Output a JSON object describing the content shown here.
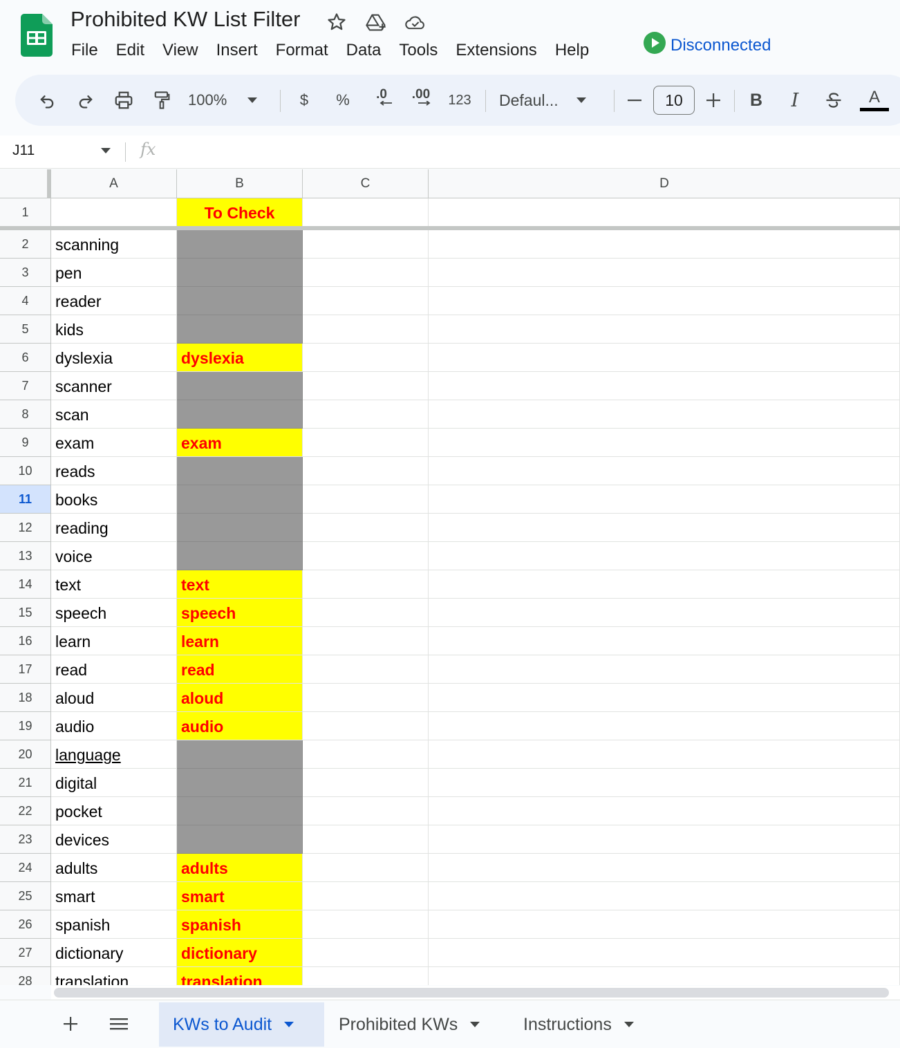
{
  "app": {
    "title": "Prohibited KW List Filter",
    "menu": [
      "File",
      "Edit",
      "View",
      "Insert",
      "Format",
      "Data",
      "Tools",
      "Extensions",
      "Help"
    ],
    "connection_status": "Disconnected"
  },
  "toolbar": {
    "zoom": "100%",
    "currency": "$",
    "percent": "%",
    "decrease_decimal": ".0",
    "increase_decimal": ".00",
    "number_format": "123",
    "font": "Defaul...",
    "font_size": "10",
    "bold": "B",
    "italic": "I",
    "text_color": "A"
  },
  "formula_bar": {
    "cell_ref": "J11",
    "fx": "fx",
    "value": ""
  },
  "sheet": {
    "columns": [
      "A",
      "B",
      "C",
      "D"
    ],
    "active_row": 11,
    "header_row": {
      "row": 1,
      "a": "",
      "b": "To Check"
    },
    "rows": [
      {
        "n": 2,
        "a": "scanning",
        "b": ""
      },
      {
        "n": 3,
        "a": "pen",
        "b": ""
      },
      {
        "n": 4,
        "a": "reader",
        "b": ""
      },
      {
        "n": 5,
        "a": "kids",
        "b": ""
      },
      {
        "n": 6,
        "a": "dyslexia",
        "b": "dyslexia"
      },
      {
        "n": 7,
        "a": "scanner",
        "b": ""
      },
      {
        "n": 8,
        "a": "scan",
        "b": ""
      },
      {
        "n": 9,
        "a": "exam",
        "b": "exam"
      },
      {
        "n": 10,
        "a": "reads",
        "b": ""
      },
      {
        "n": 11,
        "a": "books",
        "b": ""
      },
      {
        "n": 12,
        "a": "reading",
        "b": ""
      },
      {
        "n": 13,
        "a": "voice",
        "b": ""
      },
      {
        "n": 14,
        "a": "text",
        "b": "text"
      },
      {
        "n": 15,
        "a": "speech",
        "b": "speech"
      },
      {
        "n": 16,
        "a": "learn",
        "b": "learn"
      },
      {
        "n": 17,
        "a": "read",
        "b": "read"
      },
      {
        "n": 18,
        "a": "aloud",
        "b": "aloud"
      },
      {
        "n": 19,
        "a": "audio",
        "b": "audio"
      },
      {
        "n": 20,
        "a": "language",
        "b": ""
      },
      {
        "n": 21,
        "a": "digital",
        "b": ""
      },
      {
        "n": 22,
        "a": "pocket",
        "b": ""
      },
      {
        "n": 23,
        "a": "devices",
        "b": ""
      },
      {
        "n": 24,
        "a": "adults",
        "b": "adults"
      },
      {
        "n": 25,
        "a": "smart",
        "b": "smart"
      },
      {
        "n": 26,
        "a": "spanish",
        "b": "spanish"
      },
      {
        "n": 27,
        "a": "dictionary",
        "b": "dictionary"
      },
      {
        "n": 28,
        "a": "translation",
        "b": "translation"
      }
    ]
  },
  "sheet_tabs": [
    {
      "label": "KWs to Audit",
      "active": true
    },
    {
      "label": "Prohibited KWs",
      "active": false
    },
    {
      "label": "Instructions",
      "active": false
    }
  ],
  "colors": {
    "highlight_fill": "#ffff00",
    "highlight_text": "#ff0000",
    "empty_fill": "#999999",
    "accent": "#0b57d0",
    "sheets_green": "#0f9d58"
  }
}
